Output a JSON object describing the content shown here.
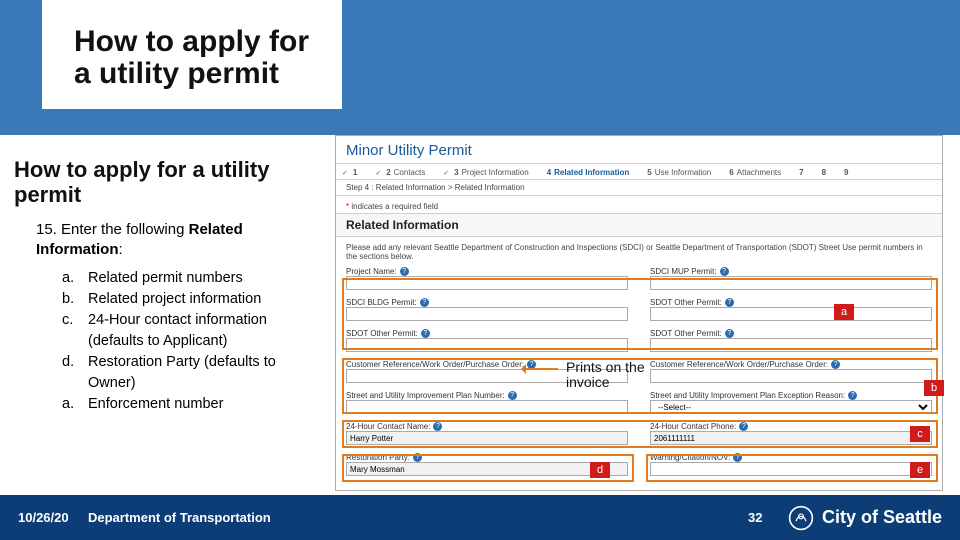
{
  "title": "How to apply for a utility permit",
  "heading": "How to apply for a utility permit",
  "step_number": "15.",
  "step_text_a": "Enter the following ",
  "step_text_b": "Related Information",
  "step_text_c": ":",
  "sub_items": [
    {
      "label": "a.",
      "text": "Related permit numbers"
    },
    {
      "label": "b.",
      "text": "Related project information"
    },
    {
      "label": "c.",
      "text": "24-Hour contact information (defaults to Applicant)"
    },
    {
      "label": "d.",
      "text": "Restoration Party (defaults to Owner)"
    },
    {
      "label": "a.",
      "text": "Enforcement number"
    }
  ],
  "footer": {
    "date": "10/26/20",
    "dept": "Department of Transportation",
    "page": "32",
    "city": "City of Seattle"
  },
  "form": {
    "title": "Minor Utility Permit",
    "wizard": [
      {
        "n": "1",
        "label": ""
      },
      {
        "n": "2",
        "label": "Contacts"
      },
      {
        "n": "3",
        "label": "Project Information"
      },
      {
        "n": "4",
        "label": "Related Information"
      },
      {
        "n": "5",
        "label": "Use Information"
      },
      {
        "n": "6",
        "label": "Attachments"
      },
      {
        "n": "7",
        "label": ""
      },
      {
        "n": "8",
        "label": ""
      },
      {
        "n": "9",
        "label": ""
      }
    ],
    "breadcrumb": "Step 4 : Related Information > Related Information",
    "required": "indicates a required field",
    "section": "Related Information",
    "hint": "Please add any relevant Seattle Department of Construction and Inspections (SDCI) or Seattle Department of Transportation (SDOT) Street Use permit numbers in the sections below.",
    "labels": {
      "project_name": "Project Name:",
      "sdci_mup": "SDCI MUP Permit:",
      "sdci_bldg": "SDCI BLDG Permit:",
      "sdot_other": "SDOT Other Permit:",
      "sdot_other2": "SDOT Other Permit:",
      "sdot_other3": "SDOT Other Permit:",
      "cust_ref": "Customer Reference/Work Order/Purchase Order:",
      "suip": "Street and Utility Improvement Plan Number:",
      "suip_reason": "Street and Utility Improvement Plan Exception Reason:",
      "contact_name": "24-Hour Contact Name:",
      "contact_phone": "24-Hour Contact Phone:",
      "restoration": "Restoration Party:",
      "warning": "Warning/Citation/NOV:"
    },
    "values": {
      "suip_reason": "--Select--",
      "contact_name": "Harry Potter",
      "contact_phone": "2061111111",
      "restoration": "Mary Mossman"
    }
  },
  "annotation": "Prints on the invoice",
  "tags": {
    "a": "a",
    "b": "b",
    "c": "c",
    "d": "d",
    "e": "e"
  }
}
